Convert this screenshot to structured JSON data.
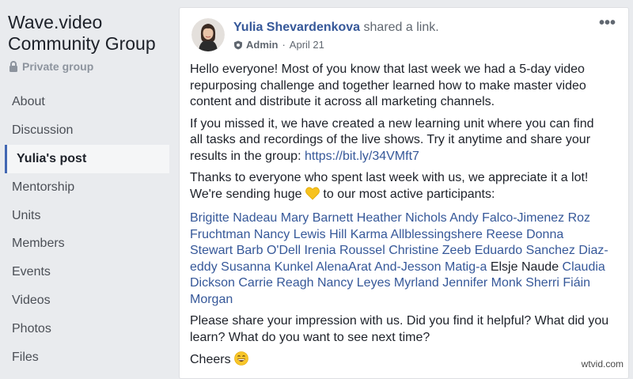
{
  "sidebar": {
    "group_title": "Wave.video Community Group",
    "privacy": "Private group",
    "items": [
      {
        "label": "About",
        "active": false
      },
      {
        "label": "Discussion",
        "active": false
      },
      {
        "label": "Yulia's post",
        "active": true
      },
      {
        "label": "Mentorship",
        "active": false
      },
      {
        "label": "Units",
        "active": false
      },
      {
        "label": "Members",
        "active": false
      },
      {
        "label": "Events",
        "active": false
      },
      {
        "label": "Videos",
        "active": false
      },
      {
        "label": "Photos",
        "active": false
      },
      {
        "label": "Files",
        "active": false
      }
    ]
  },
  "post": {
    "author": "Yulia Shevardenkova",
    "action": "shared a link.",
    "role": "Admin",
    "date": "April 21",
    "more_label": "•••",
    "paragraph1": "Hello everyone! Most of you know that last week we had a 5-day video repurposing challenge and together learned how to make master video content and distribute it across all marketing channels.",
    "paragraph2_before": "If you missed it, we have created a new learning unit where you can find all tasks and recordings of the live shows. Try it anytime and share your results in the group: ",
    "paragraph2_link": "https://bit.ly/34VMft7",
    "paragraph3_before": "Thanks to everyone who spent last week with us, we appreciate it a lot! We're sending huge ",
    "paragraph3_after": " to our most active participants:",
    "mentions": [
      {
        "name": "Brigitte Nadeau",
        "linked": true
      },
      {
        "name": "Mary Barnett",
        "linked": true
      },
      {
        "name": "Heather Nichols",
        "linked": true
      },
      {
        "name": "Andy Falco-Jimenez",
        "linked": true
      },
      {
        "name": "Roz Fruchtman",
        "linked": true
      },
      {
        "name": "Nancy Lewis Hill",
        "linked": true
      },
      {
        "name": "Karma Allblessingshere",
        "linked": true
      },
      {
        "name": "Reese Donna Stewart",
        "linked": true
      },
      {
        "name": "Barb O'Dell",
        "linked": true
      },
      {
        "name": "Irenia Roussel",
        "linked": true
      },
      {
        "name": "Christine Zeeb",
        "linked": true
      },
      {
        "name": "Eduardo Sanchez",
        "linked": true
      },
      {
        "name": "Diaz-eddy Susanna Kunkel",
        "linked": true
      },
      {
        "name": "AlenaArat",
        "linked": true
      },
      {
        "name": "And-Jesson Matig-a",
        "linked": true
      },
      {
        "name": "Elsje Naude",
        "linked": false
      },
      {
        "name": "Claudia Dickson",
        "linked": true
      },
      {
        "name": "Carrie Reagh",
        "linked": true
      },
      {
        "name": "Nancy Leyes",
        "linked": true
      },
      {
        "name": "Myrland",
        "linked": true
      },
      {
        "name": "Jennifer Monk",
        "linked": true
      },
      {
        "name": "Sherri Fiáin Morgan",
        "linked": true
      }
    ],
    "paragraph4": "Please share your impression with us. Did you find it helpful? What did you learn? What do you want to see next time?",
    "closing": "Cheers"
  },
  "icons": {
    "lock": "lock-icon",
    "admin_badge": "shield-badge-icon",
    "heart": "yellow-heart-icon",
    "smile": "grinning-face-icon"
  },
  "colors": {
    "background": "#e9ebee",
    "link": "#365899",
    "active_indicator": "#4267b2",
    "heart": "#f7c21f",
    "smile": "#f8c62a"
  },
  "watermark": "wtvid.com"
}
